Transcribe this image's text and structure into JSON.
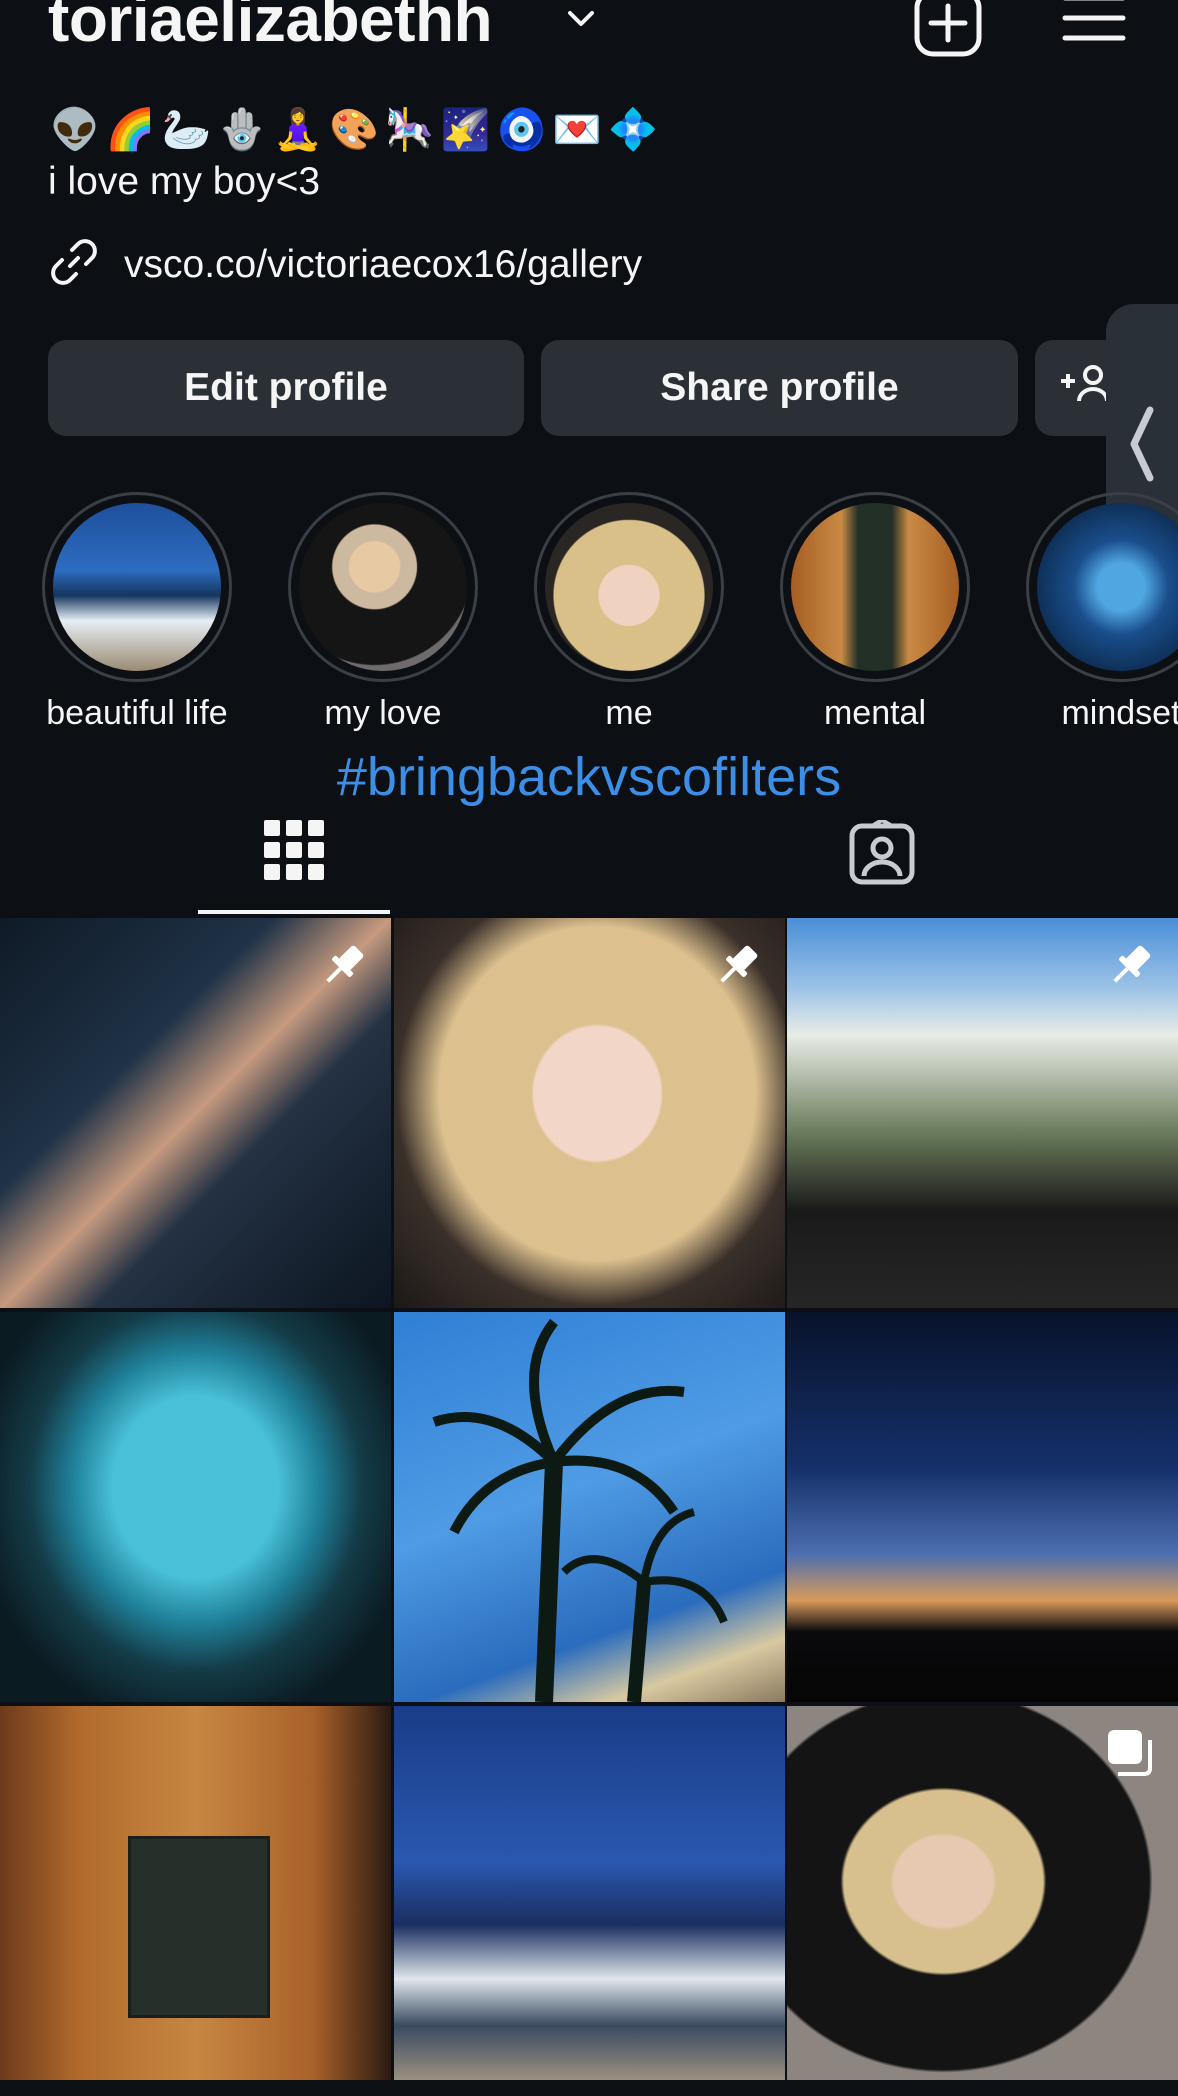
{
  "header": {
    "username": "toriaelizabethh",
    "icons": {
      "dropdown": "chevron-down-icon",
      "create": "plus-square-icon",
      "menu": "hamburger-menu-icon"
    }
  },
  "bio": {
    "emojis": "👽🌈🦢🪬🧘‍♀️🎨🎠🌠🧿💌💠",
    "text": "i love my boy<3",
    "link": "vsco.co/victoriaecox16/gallery"
  },
  "actions": {
    "edit_profile": "Edit profile",
    "share_profile": "Share profile",
    "add_user_icon": "add-person-icon"
  },
  "highlights": [
    {
      "label": "beautiful life"
    },
    {
      "label": "my love"
    },
    {
      "label": "me"
    },
    {
      "label": "mental"
    },
    {
      "label": "mindset"
    }
  ],
  "hashtag": "#bringbackvscofilters",
  "tabs": [
    {
      "icon": "grid-icon",
      "active": true
    },
    {
      "icon": "tagged-person-icon",
      "active": false
    }
  ],
  "posts": [
    {
      "subject": "hands in car",
      "badge": "pin-icon"
    },
    {
      "subject": "selfie",
      "badge": "pin-icon"
    },
    {
      "subject": "balcony",
      "badge": "pin-icon"
    },
    {
      "subject": "aquarium",
      "badge": ""
    },
    {
      "subject": "palm trees",
      "badge": ""
    },
    {
      "subject": "sunset palms",
      "badge": ""
    },
    {
      "subject": "wood door sign",
      "badge": ""
    },
    {
      "subject": "ocean waves",
      "badge": ""
    },
    {
      "subject": "mirror selfie",
      "badge": "carousel-icon"
    }
  ],
  "colors": {
    "background": "#0c1014",
    "button": "#2b3036",
    "hashtag": "#3d8ee6"
  }
}
